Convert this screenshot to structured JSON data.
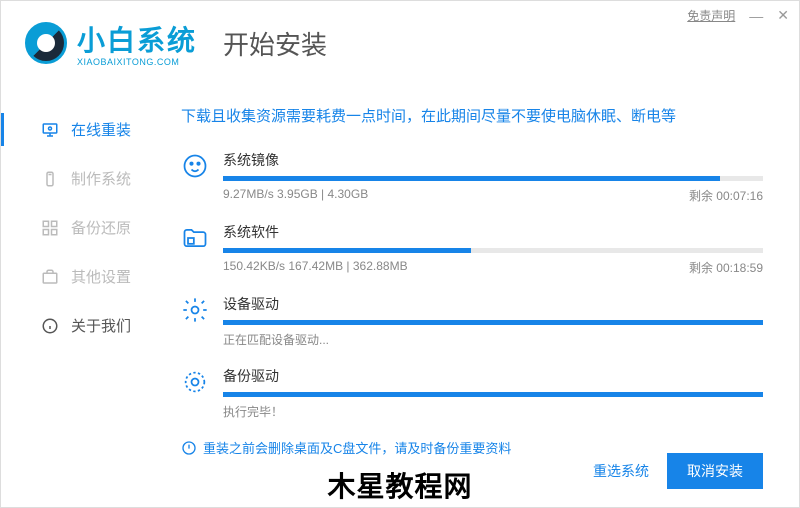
{
  "titlebar": {
    "disclaimer": "免责声明"
  },
  "brand": {
    "name": "小白系统",
    "domain": "XIAOBAIXITONG.COM"
  },
  "page_title": "开始安装",
  "sidebar": {
    "items": [
      {
        "label": "在线重装"
      },
      {
        "label": "制作系统"
      },
      {
        "label": "备份还原"
      },
      {
        "label": "其他设置"
      },
      {
        "label": "关于我们"
      }
    ]
  },
  "notice": "下载且收集资源需要耗费一点时间，在此期间尽量不要使电脑休眠、断电等",
  "tasks": [
    {
      "title": "系统镜像",
      "info": "9.27MB/s 3.95GB | 4.30GB",
      "remain": "剩余 00:07:16",
      "pct": 92
    },
    {
      "title": "系统软件",
      "info": "150.42KB/s 167.42MB | 362.88MB",
      "remain": "剩余 00:18:59",
      "pct": 46
    },
    {
      "title": "设备驱动",
      "info": "正在匹配设备驱动...",
      "remain": "",
      "pct": 100
    },
    {
      "title": "备份驱动",
      "info": "执行完毕！",
      "remain": "",
      "pct": 100
    }
  ],
  "warning": "重装之前会删除桌面及C盘文件，请及时备份重要资料",
  "footer": {
    "reselect": "重选系统",
    "cancel": "取消安装"
  },
  "watermark": "木星教程网"
}
